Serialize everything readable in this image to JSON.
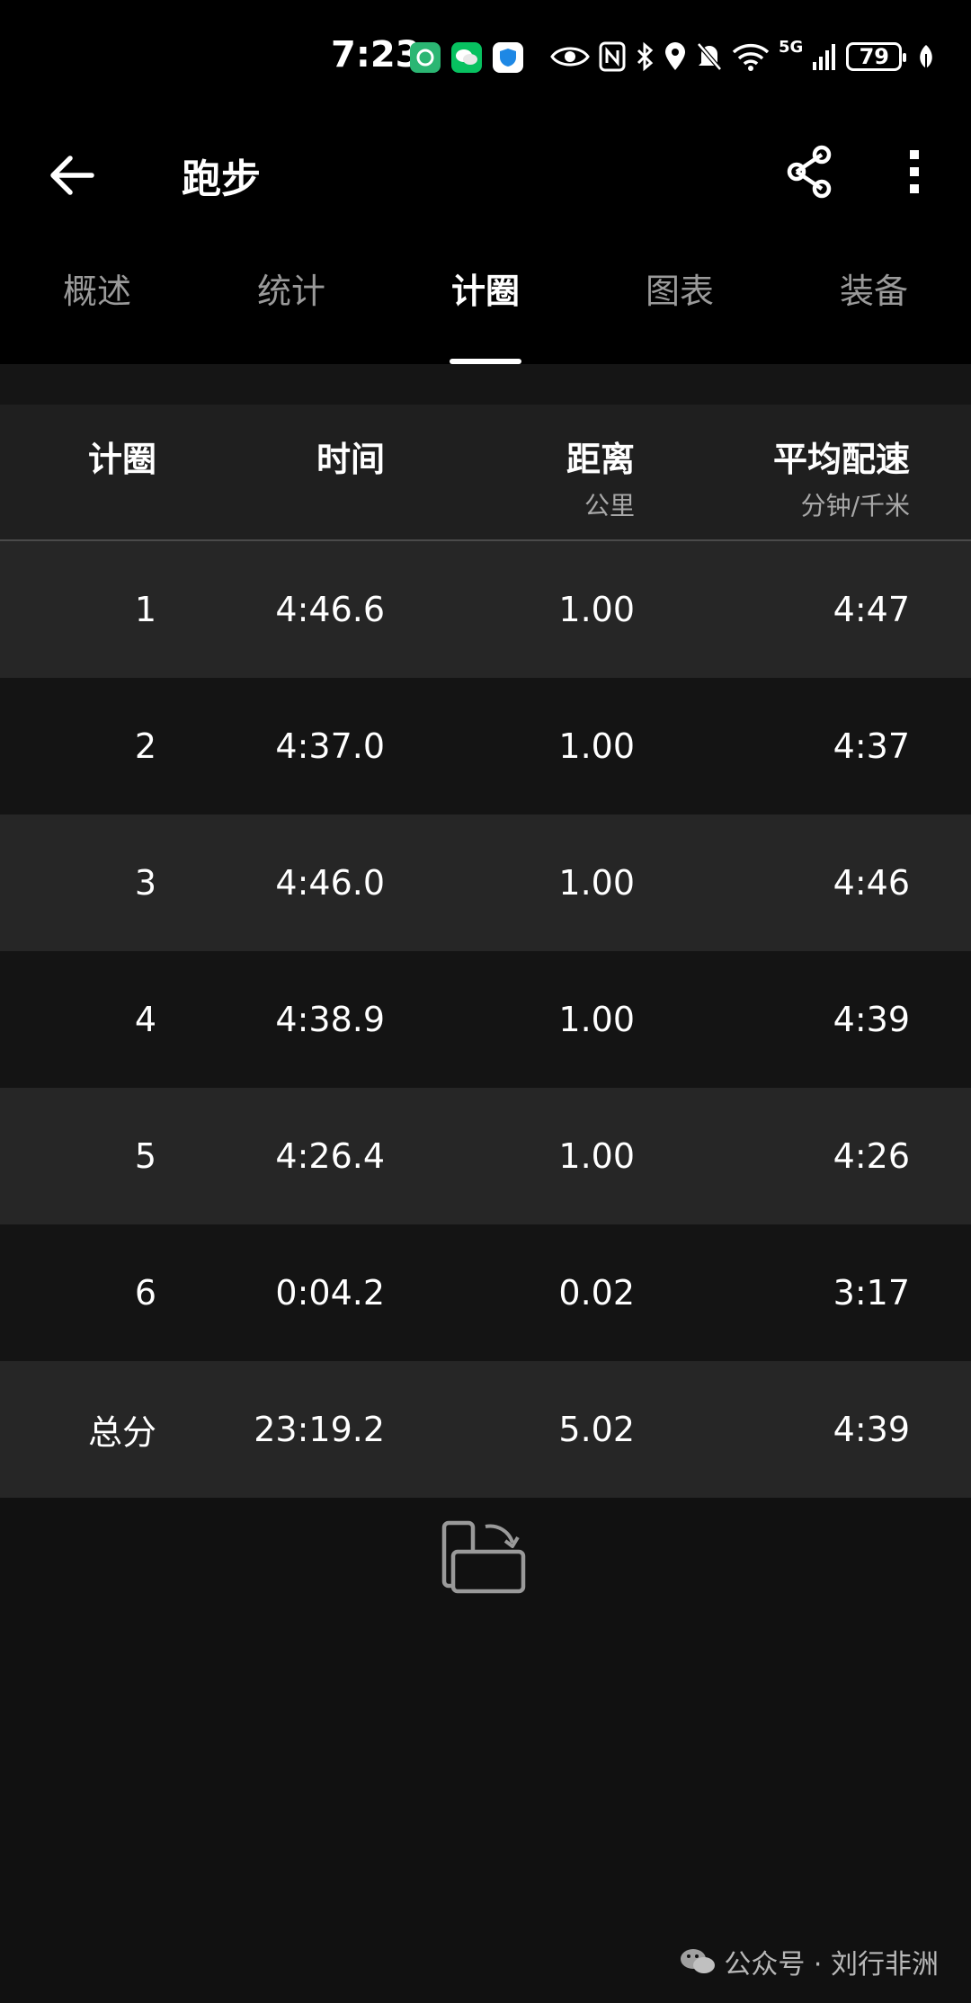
{
  "status_bar": {
    "time": "7:23",
    "battery": "79",
    "network": "5G",
    "icons": [
      "app-green-icon",
      "wechat-icon",
      "shield-app-icon",
      "eye-icon",
      "nfc-icon",
      "bluetooth-icon",
      "location-icon",
      "mute-icon",
      "wifi-icon",
      "signal-icon",
      "battery-icon",
      "leaf-icon"
    ]
  },
  "app_bar": {
    "title": "跑步"
  },
  "tabs": [
    {
      "label": "概述",
      "active": false
    },
    {
      "label": "统计",
      "active": false
    },
    {
      "label": "计圈",
      "active": true
    },
    {
      "label": "图表",
      "active": false
    },
    {
      "label": "装备",
      "active": false
    }
  ],
  "table": {
    "headers": {
      "lap": "计圈",
      "time": "时间",
      "distance": "距离",
      "distance_unit": "公里",
      "pace": "平均配速",
      "pace_unit": "分钟/千米"
    },
    "rows": [
      {
        "lap": "1",
        "time": "4:46.6",
        "distance": "1.00",
        "pace": "4:47"
      },
      {
        "lap": "2",
        "time": "4:37.0",
        "distance": "1.00",
        "pace": "4:37"
      },
      {
        "lap": "3",
        "time": "4:46.0",
        "distance": "1.00",
        "pace": "4:46"
      },
      {
        "lap": "4",
        "time": "4:38.9",
        "distance": "1.00",
        "pace": "4:39"
      },
      {
        "lap": "5",
        "time": "4:26.4",
        "distance": "1.00",
        "pace": "4:26"
      },
      {
        "lap": "6",
        "time": "0:04.2",
        "distance": "0.02",
        "pace": "3:17"
      }
    ],
    "total": {
      "lap": "总分",
      "time": "23:19.2",
      "distance": "5.02",
      "pace": "4:39"
    }
  },
  "watermark": {
    "text": "公众号 · 刘行非洲"
  },
  "colors": {
    "background": "#111111",
    "bar": "#000000",
    "row_light": "#262626",
    "row_dark": "#141414",
    "tab_inactive": "#9a9a9a"
  }
}
